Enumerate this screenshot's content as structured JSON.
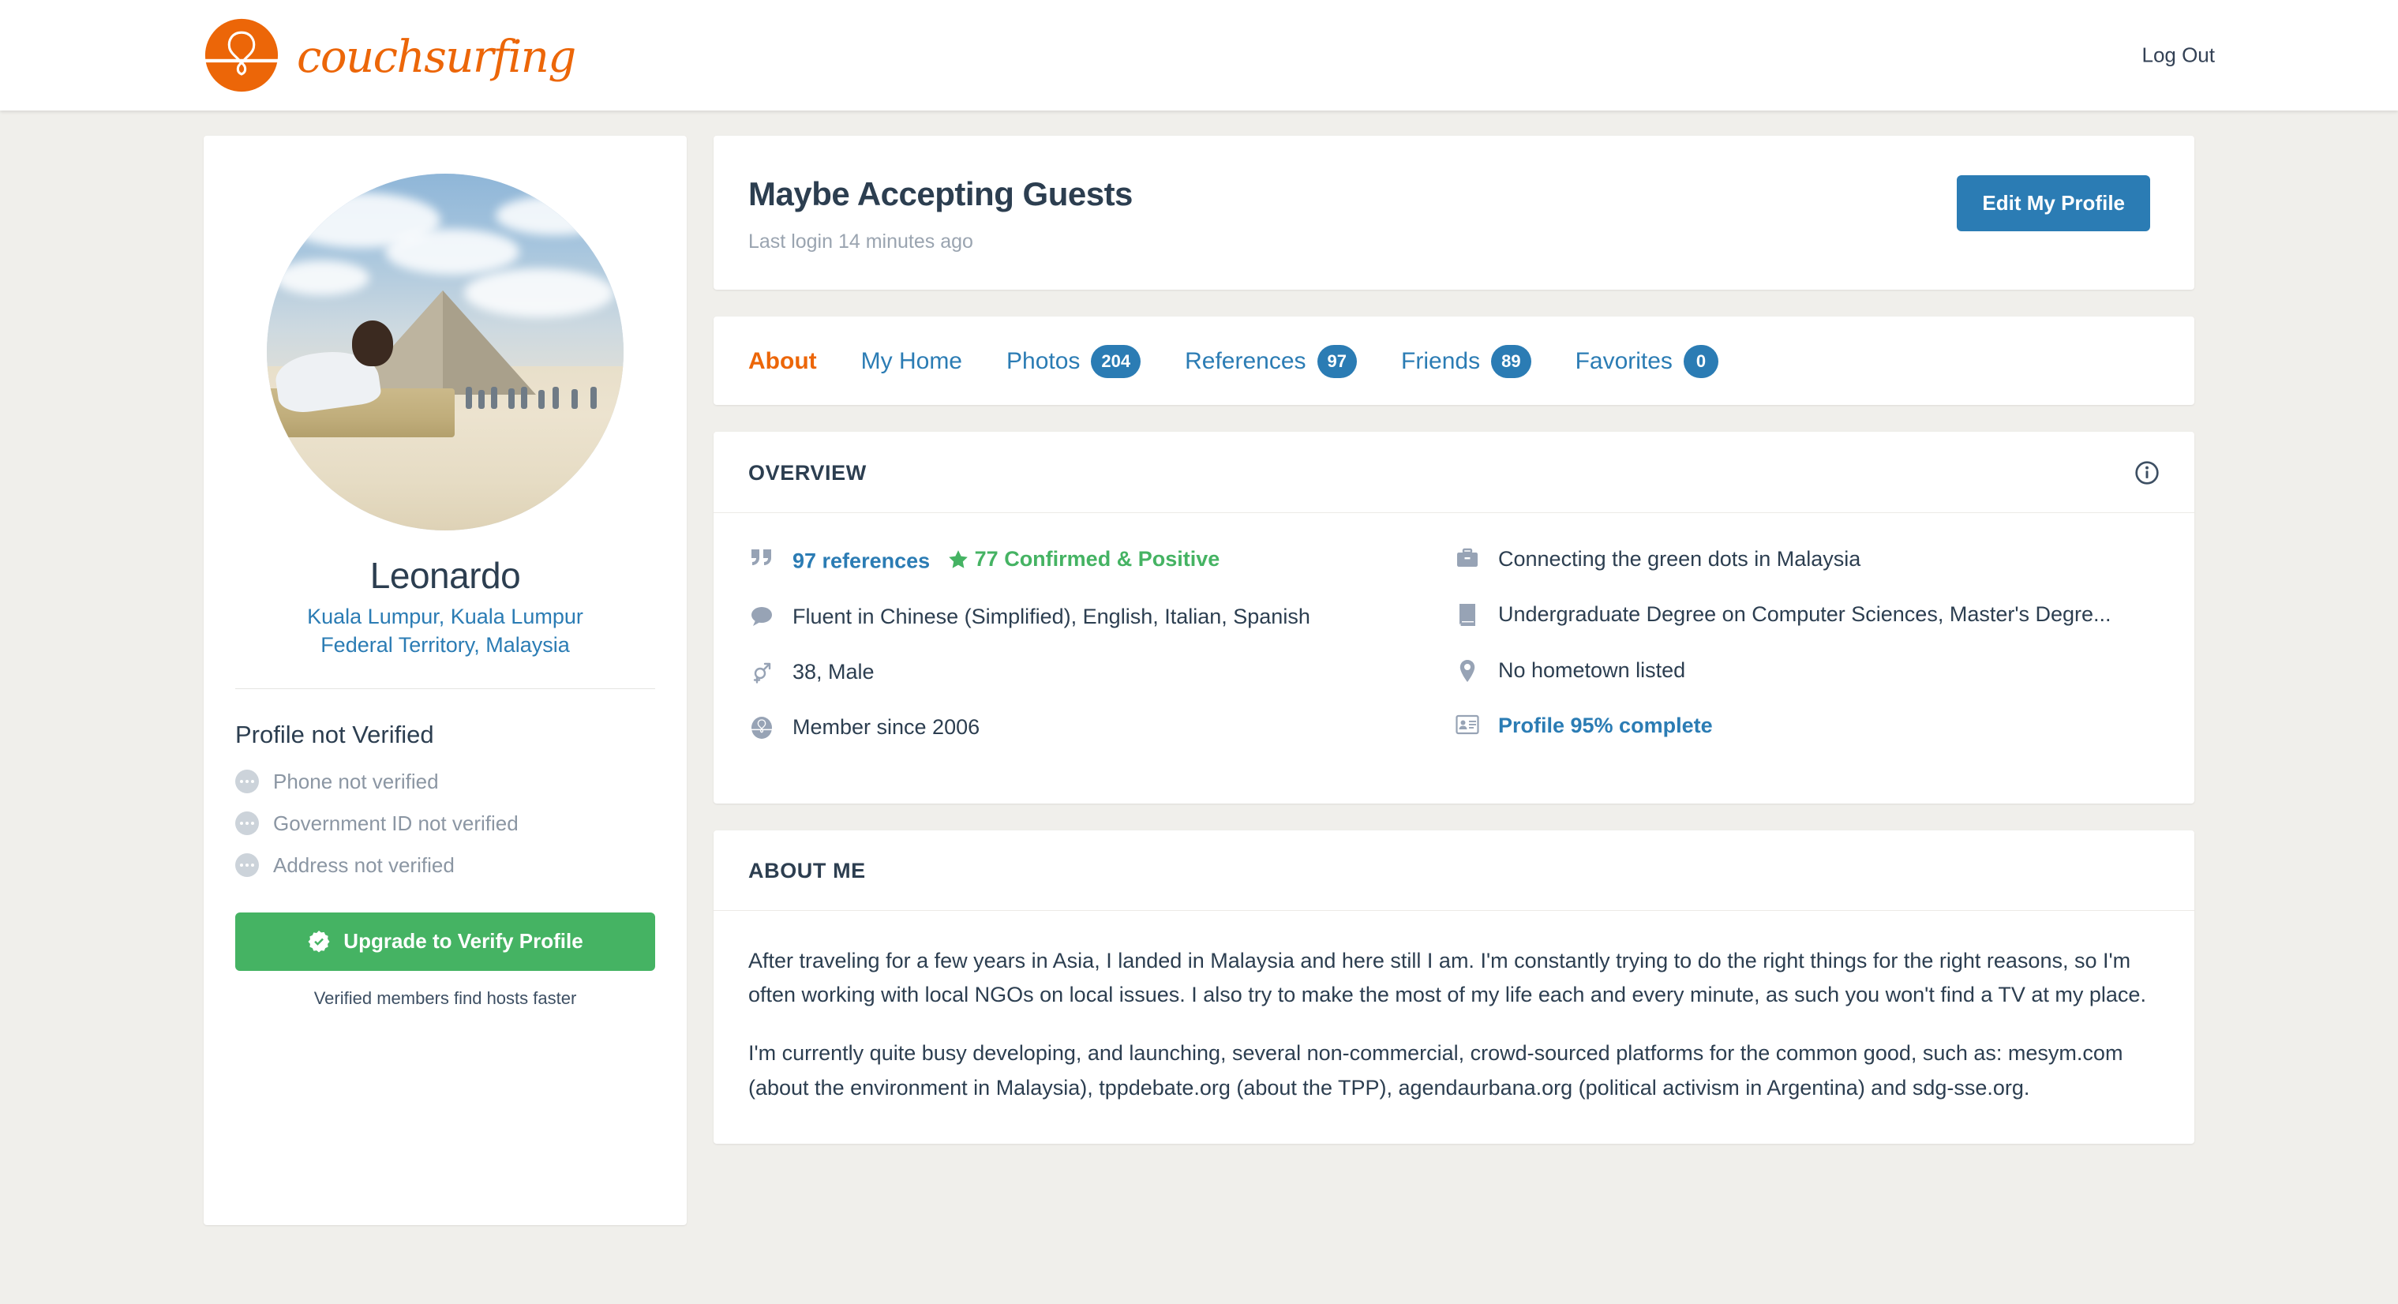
{
  "brand": {
    "name": "couchsurfing",
    "logo_icon": "couchsurfing-balloon-logo",
    "accent_color": "#ec6608"
  },
  "topbar": {
    "logout_label": "Log Out"
  },
  "sidebar": {
    "avatar_alt": "profile-photo-pyramid",
    "name": "Leonardo",
    "location_line1": "Kuala Lumpur, Kuala Lumpur",
    "location_line2": "Federal Territory, Malaysia",
    "verification_title": "Profile not Verified",
    "verification_items": [
      {
        "label": "Phone not verified",
        "icon": "ellipsis-circle-icon"
      },
      {
        "label": "Government ID not verified",
        "icon": "ellipsis-circle-icon"
      },
      {
        "label": "Address not verified",
        "icon": "ellipsis-circle-icon"
      }
    ],
    "upgrade_label": "Upgrade to Verify Profile",
    "upgrade_icon": "verified-badge-icon",
    "upgrade_color": "#45b363",
    "upgrade_subtext": "Verified members find hosts faster"
  },
  "header": {
    "title": "Maybe Accepting Guests",
    "last_login": "Last login 14 minutes ago",
    "edit_button": "Edit My Profile",
    "edit_button_color": "#2b7cb4"
  },
  "tabs": [
    {
      "label": "About",
      "badge": null,
      "active": true
    },
    {
      "label": "My Home",
      "badge": null,
      "active": false
    },
    {
      "label": "Photos",
      "badge": "204",
      "active": false
    },
    {
      "label": "References",
      "badge": "97",
      "active": false
    },
    {
      "label": "Friends",
      "badge": "89",
      "active": false
    },
    {
      "label": "Favorites",
      "badge": "0",
      "active": false
    }
  ],
  "overview": {
    "heading": "OVERVIEW",
    "info_icon": "info-circle-icon",
    "left": [
      {
        "icon": "quote-icon",
        "link_text": "97 references",
        "star_icon": "star-icon",
        "positive_text": "77 Confirmed & Positive"
      },
      {
        "icon": "speech-bubble-icon",
        "text": "Fluent in Chinese (Simplified), English, Italian, Spanish"
      },
      {
        "icon": "gender-icon",
        "text": "38, Male"
      },
      {
        "icon": "couchsurfing-balloon-icon",
        "text": "Member since 2006"
      }
    ],
    "right": [
      {
        "icon": "briefcase-icon",
        "text": "Connecting the green dots in Malaysia"
      },
      {
        "icon": "book-icon",
        "text": "Undergraduate Degree on Computer Sciences, Master's Degre..."
      },
      {
        "icon": "location-pin-icon",
        "text": "No hometown listed"
      },
      {
        "icon": "id-card-icon",
        "link_text": "Profile 95% complete"
      }
    ]
  },
  "about_me": {
    "heading": "ABOUT ME",
    "paragraphs": [
      "After traveling for a few years in Asia, I landed in Malaysia and here still I am. I'm constantly trying to do the right things for the right reasons, so I'm often working with local NGOs on local issues. I also try to make the most of my life each and every minute, as such you won't find a TV at my place.",
      "I'm currently quite busy developing, and launching, several non-commercial, crowd-sourced platforms for the common good, such as: mesym.com (about the environment in Malaysia), tppdebate.org (about the TPP), agendaurbana.org (political activism in Argentina) and sdg-sse.org."
    ]
  }
}
